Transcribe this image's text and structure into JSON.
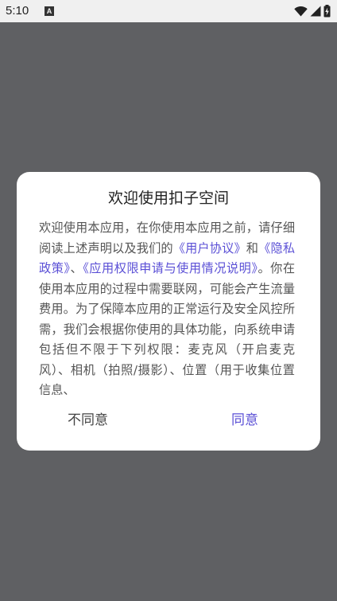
{
  "status_bar": {
    "time": "5:10",
    "notification_icon_letter": "A",
    "icons": [
      "wifi-icon",
      "signal-icon",
      "battery-charging-icon"
    ]
  },
  "dialog": {
    "title": "欢迎使用扣子空间",
    "body": {
      "text_1": "欢迎使用本应用，在你使用本应用之前，请仔细阅读上述声明以及我们的",
      "link_user_agreement": "《用户协议》",
      "text_2": "和",
      "link_privacy_policy": "《隐私政策》",
      "text_3": "、",
      "link_permissions": "《应用权限申请与使用情况说明》",
      "text_4": "。你在使用本应用的过程中需要联网，可能会产生流量费用。为了保障本应用的正常运行及安全风控所需，我们会根据你使用的具体功能，向系统申请包括但不限于下列权限：麦克风（开启麦克风）、相机（拍照/摄影）、位置（用于收集位置信息、"
    },
    "buttons": {
      "disagree": "不同意",
      "agree": "同意"
    }
  },
  "colors": {
    "overlay": "#5f6063",
    "link": "#5b50d6",
    "status_bar": "#f0f0f0"
  }
}
